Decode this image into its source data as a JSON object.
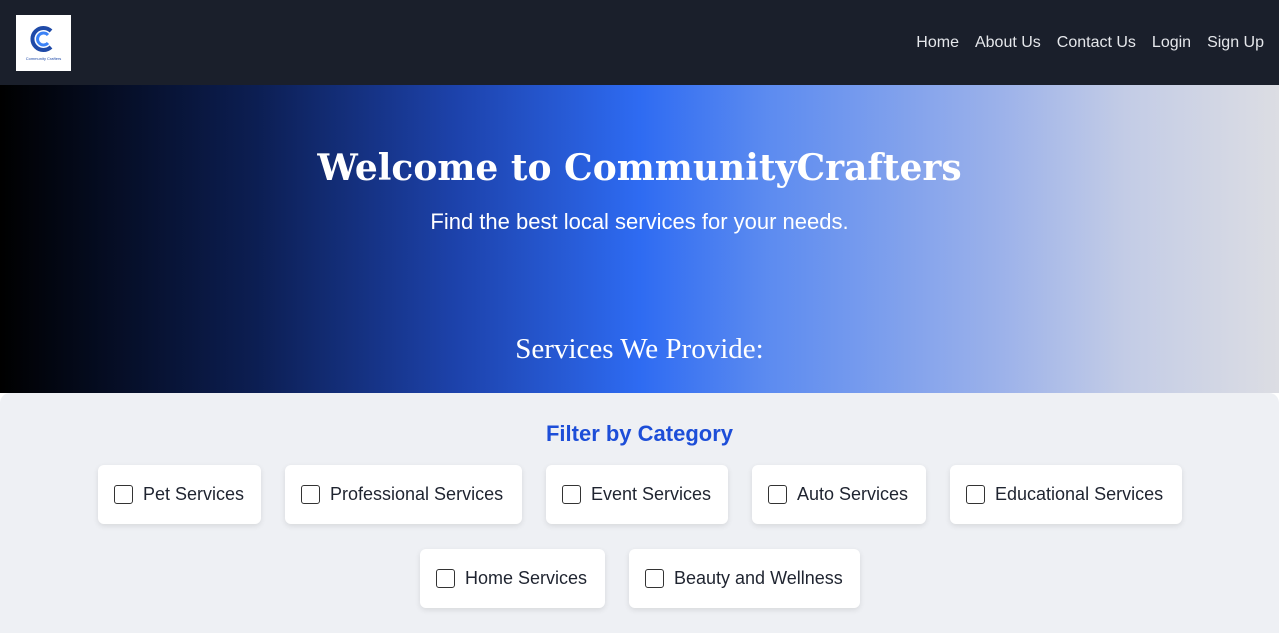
{
  "nav": {
    "logo_text": "Community Crafters",
    "links": [
      "Home",
      "About Us",
      "Contact Us",
      "Login",
      "Sign Up"
    ]
  },
  "hero": {
    "title": "Welcome to CommunityCrafters",
    "subtitle": "Find the best local services for your needs.",
    "services_heading": "Services We Provide:"
  },
  "filter": {
    "title": "Filter by Category",
    "categories": [
      "Pet Services",
      "Professional Services",
      "Event Services",
      "Auto Services",
      "Educational Services",
      "Home Services",
      "Beauty and Wellness"
    ]
  },
  "colors": {
    "navbar_bg": "#1a1f2b",
    "accent": "#1d4ed8",
    "panel_bg": "#eef0f4"
  }
}
